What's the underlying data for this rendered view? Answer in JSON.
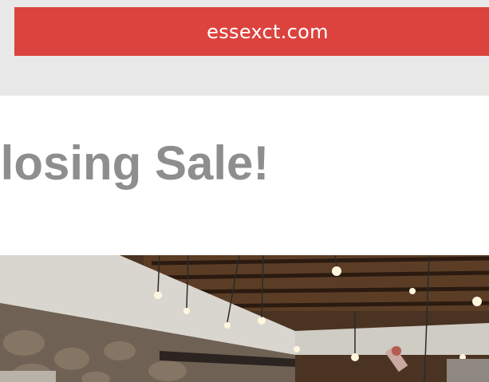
{
  "promo": {
    "site_label": "essexct.com"
  },
  "headline": {
    "text": "o Closing Sale!"
  },
  "colors": {
    "accent": "#dc433e",
    "band": "#e8e8e8",
    "headline": "#8e8e8e"
  },
  "photo": {
    "icon": "store-interior-photo"
  }
}
